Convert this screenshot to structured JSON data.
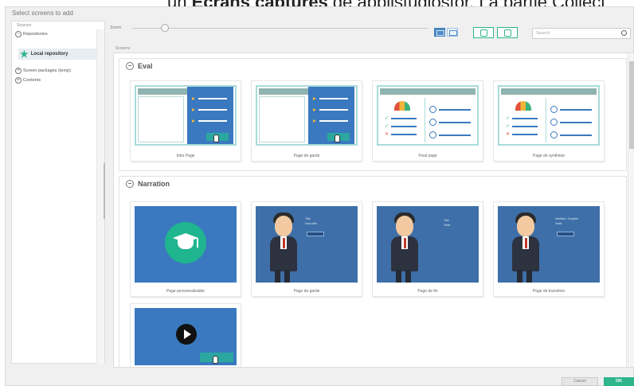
{
  "banner": {
    "prefix": "un ",
    "bold": "Ecrans capturés",
    "suffix": " de appiistudiostor. La partie Collect"
  },
  "dialog": {
    "title": "Select screens to add"
  },
  "sources": {
    "label": "Sources",
    "items": [
      "Repositories",
      "Local repository",
      "Screen packages (temp)",
      "Contents"
    ]
  },
  "toolbar": {
    "zoom_label": "Zoom",
    "search_placeholder": "Search"
  },
  "screens": {
    "label": "Screens",
    "groups": [
      {
        "title": "Eval",
        "cards": [
          "Intro Page",
          "Page de garde",
          "Final page",
          "Page de synthèse"
        ]
      },
      {
        "title": "Narration",
        "cards": [
          "Page personnalisable",
          "Page de garde",
          "Page de fin",
          "Page de transition",
          ""
        ]
      }
    ]
  },
  "narration_texts": {
    "garde_title": "Titre",
    "garde_sub": "Sous-titre",
    "fin_title": "Titre",
    "fin_sub": "Texte",
    "trans_title": "Intertitre / Chapitre",
    "trans_sub": "Texte"
  },
  "footer": {
    "cancel": "Cancel",
    "ok": "OK"
  },
  "colors": {
    "accent": "#2fb58b",
    "blue": "#3a79bf",
    "teal_border": "#a7dcd8"
  }
}
